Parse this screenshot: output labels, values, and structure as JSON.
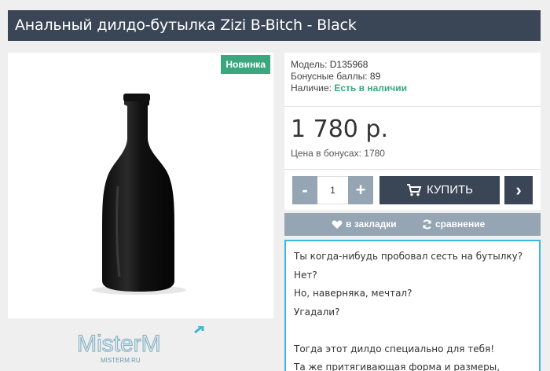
{
  "product": {
    "title": "Анальный дилдо-бутылка Zizi B-Bitch - Black",
    "badge": "Новинка",
    "watermark_brand": "MisterM",
    "watermark_url": "MISTERM.RU"
  },
  "info": {
    "model_label": "Модель:",
    "model_value": "D135968",
    "bonus_label": "Бонусные баллы:",
    "bonus_value": "89",
    "stock_label": "Наличие:",
    "stock_value": "Есть в наличии"
  },
  "price": {
    "value": "1 780 р.",
    "bonus_price": "Цена в бонусах: 1780"
  },
  "cart": {
    "minus": "-",
    "quantity": "1",
    "plus": "+",
    "buy_label": "КУПИТЬ",
    "next": "›"
  },
  "actions": {
    "wishlist": "в закладки",
    "compare": "сравнение"
  },
  "description": {
    "lines": [
      "Ты когда-нибудь пробовал сесть на бутылку?",
      "Нет?",
      "Но, наверняка, мечтал?",
      "Угадали?",
      "",
      "Тогда этот дилдо специально для тебя!",
      "Та же притягивающая форма и размеры,"
    ]
  },
  "colors": {
    "title_bg": "#3a4656",
    "accent_green": "#3aa77e",
    "button_grey": "#95a5b3",
    "border_blue": "#3bb7d9"
  }
}
